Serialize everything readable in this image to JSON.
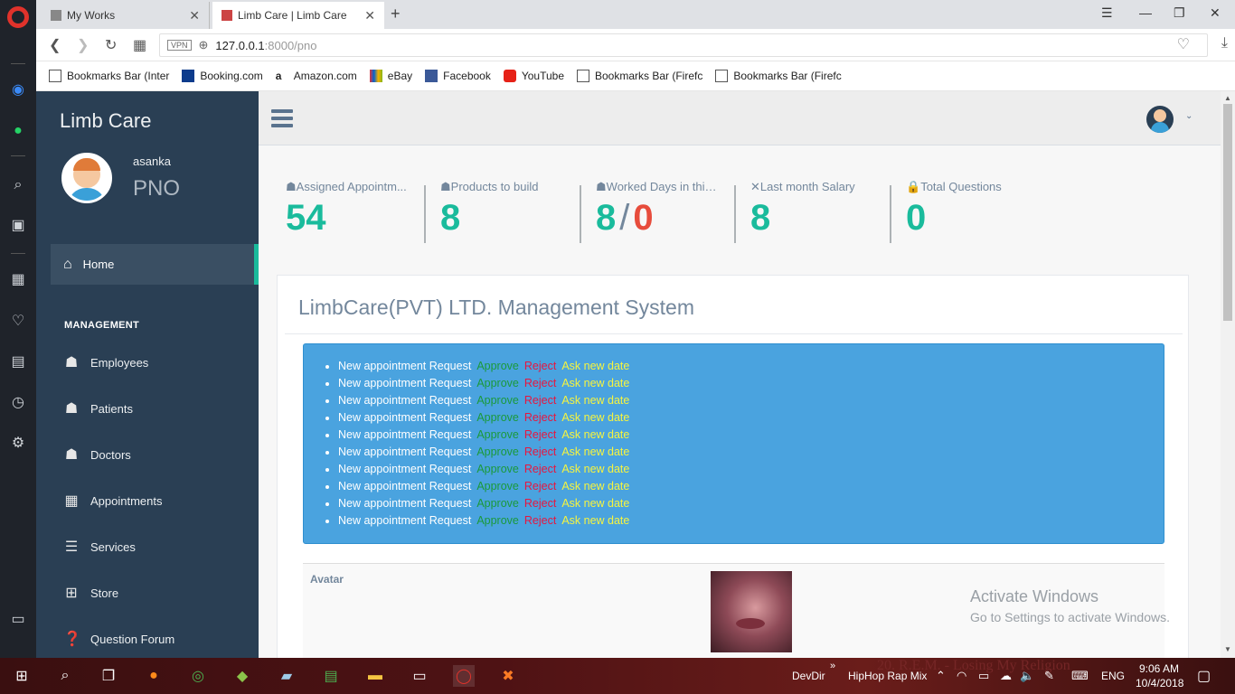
{
  "browser": {
    "tabs": [
      {
        "label": "My Works"
      },
      {
        "label": "Limb Care | Limb Care"
      }
    ],
    "url_host": "127.0.0.1",
    "url_path": ":8000/pno",
    "vpn_label": "VPN",
    "bookmarks": [
      {
        "label": "Bookmarks Bar (Inter",
        "icon": "folder-icon"
      },
      {
        "label": "Booking.com",
        "icon": "booking-icon"
      },
      {
        "label": "Amazon.com",
        "icon": "amazon-icon"
      },
      {
        "label": "eBay",
        "icon": "ebay-icon"
      },
      {
        "label": "Facebook",
        "icon": "facebook-icon"
      },
      {
        "label": "YouTube",
        "icon": "youtube-icon"
      },
      {
        "label": "Bookmarks Bar (Firefc",
        "icon": "folder-icon"
      },
      {
        "label": "Bookmarks Bar (Firefc",
        "icon": "folder-icon"
      }
    ]
  },
  "sidebar": {
    "brand": "Limb Care",
    "user_name": "asanka",
    "user_role": "PNO",
    "home_label": "Home",
    "section_title": "MANAGEMENT",
    "items": [
      {
        "label": "Employees",
        "icon": "users-icon"
      },
      {
        "label": "Patients",
        "icon": "users-icon"
      },
      {
        "label": "Doctors",
        "icon": "users-icon"
      },
      {
        "label": "Appointments",
        "icon": "calendar-icon"
      },
      {
        "label": "Services",
        "icon": "list-icon"
      },
      {
        "label": "Store",
        "icon": "sitemap-icon"
      },
      {
        "label": "Question Forum",
        "icon": "question-icon"
      }
    ]
  },
  "stats": [
    {
      "label": "Assigned Appointm...",
      "value": "54"
    },
    {
      "label": "Products to build",
      "value": "8"
    },
    {
      "label": "Worked Days in this ...",
      "value": "8",
      "value2": "0"
    },
    {
      "label": "Last month Salary",
      "value": "8"
    },
    {
      "label": "Total Questions",
      "value": "0"
    }
  ],
  "panel": {
    "title": "LimbCare(PVT) LTD. Management System",
    "notice_item": {
      "text": "New appointment Request",
      "approve": "Approve",
      "reject": "Reject",
      "ask": "Ask new date"
    },
    "notice_count": 10,
    "avatar_label": "Avatar"
  },
  "watermark": {
    "line1": "Activate Windows",
    "line2": "Go to Settings to activate Windows."
  },
  "taskbar": {
    "devdir": "DevDir",
    "music": "HipHop Rap Mix",
    "song": "20. R.E.M. - Losing My Religion",
    "lang": "ENG",
    "time": "9:06 AM",
    "date": "10/4/2018"
  },
  "colors": {
    "accent": "#1abb9c",
    "sidebar": "#2a3f54",
    "notice": "#4aa3df"
  }
}
